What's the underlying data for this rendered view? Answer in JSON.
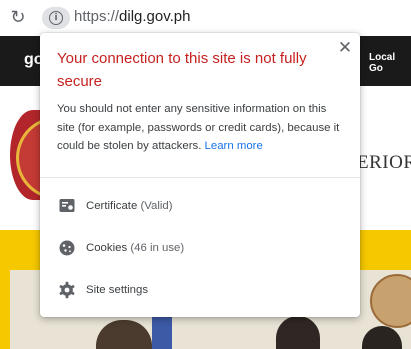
{
  "browser": {
    "reload_icon": "reload-icon",
    "info_icon": "info-icon",
    "url_scheme": "https://",
    "url_host": "dilg.gov.ph"
  },
  "page_behind": {
    "brand_fragment": "go",
    "nav_fragment": "Local Go",
    "title_fragment": "ERIOR"
  },
  "popup": {
    "title": "Your connection to this site is not fully secure",
    "title_color": "#c5221f",
    "body": "You should not enter any sensitive information on this site (for example, passwords or credit cards), because it could be stolen by attackers.",
    "learn_more": "Learn more",
    "close_icon": "close-icon",
    "items": [
      {
        "icon": "certificate-icon",
        "label": "Certificate",
        "detail": "(Valid)"
      },
      {
        "icon": "cookie-icon",
        "label": "Cookies",
        "detail": "(46 in use)"
      },
      {
        "icon": "gear-icon",
        "label": "Site settings",
        "detail": ""
      }
    ]
  }
}
